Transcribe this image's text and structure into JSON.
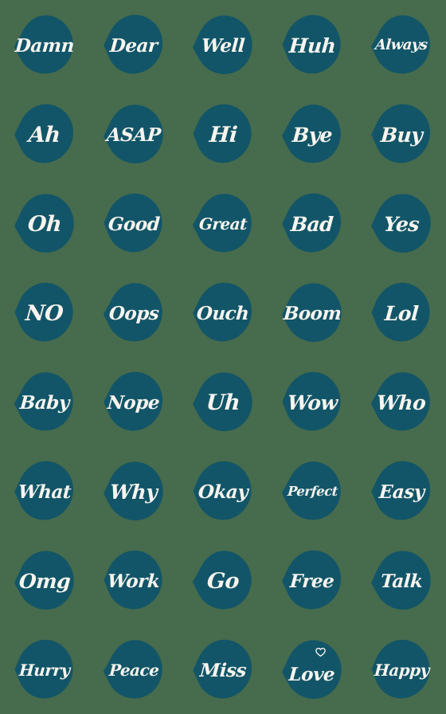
{
  "sheet": {
    "title": "Handwritten Word Sticker Sheet",
    "background_color": "#466b4d",
    "blob_color": "#125568",
    "text_color": "#f7f4ee",
    "columns": 5,
    "rows": 8,
    "sticker_count": 40
  },
  "stickers": [
    {
      "label": "Damn",
      "row": 1,
      "col": 1,
      "heart": false
    },
    {
      "label": "Dear",
      "row": 1,
      "col": 2,
      "heart": false
    },
    {
      "label": "Well",
      "row": 1,
      "col": 3,
      "heart": false
    },
    {
      "label": "Huh",
      "row": 1,
      "col": 4,
      "heart": false
    },
    {
      "label": "Always",
      "row": 1,
      "col": 5,
      "heart": false
    },
    {
      "label": "Ah",
      "row": 2,
      "col": 1,
      "heart": false
    },
    {
      "label": "ASAP",
      "row": 2,
      "col": 2,
      "heart": false
    },
    {
      "label": "Hi",
      "row": 2,
      "col": 3,
      "heart": false
    },
    {
      "label": "Bye",
      "row": 2,
      "col": 4,
      "heart": false
    },
    {
      "label": "Buy",
      "row": 2,
      "col": 5,
      "heart": false
    },
    {
      "label": "Oh",
      "row": 3,
      "col": 1,
      "heart": false
    },
    {
      "label": "Good",
      "row": 3,
      "col": 2,
      "heart": false
    },
    {
      "label": "Great",
      "row": 3,
      "col": 3,
      "heart": false
    },
    {
      "label": "Bad",
      "row": 3,
      "col": 4,
      "heart": false
    },
    {
      "label": "Yes",
      "row": 3,
      "col": 5,
      "heart": false
    },
    {
      "label": "NO",
      "row": 4,
      "col": 1,
      "heart": false
    },
    {
      "label": "Oops",
      "row": 4,
      "col": 2,
      "heart": false
    },
    {
      "label": "Ouch",
      "row": 4,
      "col": 3,
      "heart": false
    },
    {
      "label": "Boom",
      "row": 4,
      "col": 4,
      "heart": false
    },
    {
      "label": "Lol",
      "row": 4,
      "col": 5,
      "heart": false
    },
    {
      "label": "Baby",
      "row": 5,
      "col": 1,
      "heart": false
    },
    {
      "label": "Nope",
      "row": 5,
      "col": 2,
      "heart": false
    },
    {
      "label": "Uh",
      "row": 5,
      "col": 3,
      "heart": false
    },
    {
      "label": "Wow",
      "row": 5,
      "col": 4,
      "heart": false
    },
    {
      "label": "Who",
      "row": 5,
      "col": 5,
      "heart": false
    },
    {
      "label": "What",
      "row": 6,
      "col": 1,
      "heart": false
    },
    {
      "label": "Why",
      "row": 6,
      "col": 2,
      "heart": false
    },
    {
      "label": "Okay",
      "row": 6,
      "col": 3,
      "heart": false
    },
    {
      "label": "Perfect",
      "row": 6,
      "col": 4,
      "heart": false
    },
    {
      "label": "Easy",
      "row": 6,
      "col": 5,
      "heart": false
    },
    {
      "label": "Omg",
      "row": 7,
      "col": 1,
      "heart": false
    },
    {
      "label": "Work",
      "row": 7,
      "col": 2,
      "heart": false
    },
    {
      "label": "Go",
      "row": 7,
      "col": 3,
      "heart": false
    },
    {
      "label": "Free",
      "row": 7,
      "col": 4,
      "heart": false
    },
    {
      "label": "Talk",
      "row": 7,
      "col": 5,
      "heart": false
    },
    {
      "label": "Hurry",
      "row": 8,
      "col": 1,
      "heart": false
    },
    {
      "label": "Peace",
      "row": 8,
      "col": 2,
      "heart": false
    },
    {
      "label": "Miss",
      "row": 8,
      "col": 3,
      "heart": false
    },
    {
      "label": "Love",
      "row": 8,
      "col": 4,
      "heart": true
    },
    {
      "label": "Happy",
      "row": 8,
      "col": 5,
      "heart": false
    }
  ]
}
